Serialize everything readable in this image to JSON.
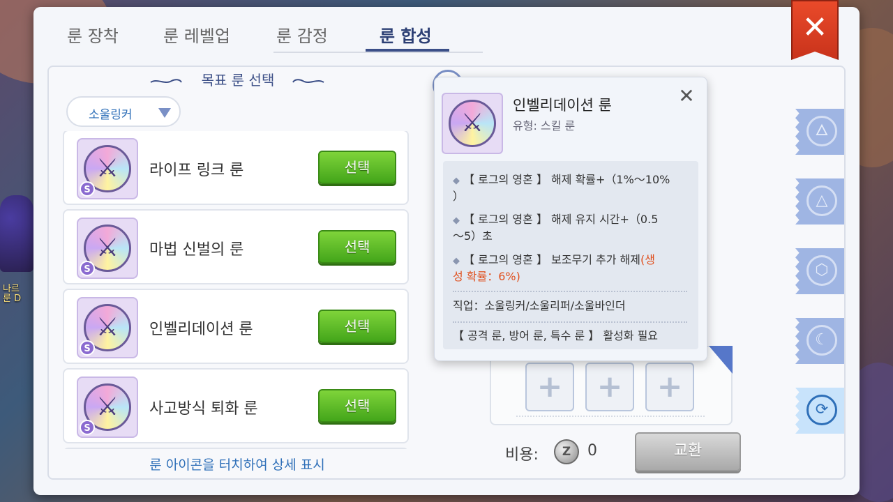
{
  "tabs": [
    {
      "label": "룬 장착",
      "active": false
    },
    {
      "label": "룬 레벨업",
      "active": false
    },
    {
      "label": "룬 감정",
      "active": false
    },
    {
      "label": "룬 합성",
      "active": true
    }
  ],
  "left_panel": {
    "title": "목표 룬 선택",
    "filter": {
      "selected": "소울링커"
    },
    "runes": [
      {
        "name": "라이프 링크 룬",
        "button": "선택",
        "badge": "S"
      },
      {
        "name": "마법 신벌의 룬",
        "button": "선택",
        "badge": "S"
      },
      {
        "name": "인벨리데이션 룬",
        "button": "선택",
        "badge": "S"
      },
      {
        "name": "사고방식 퇴화 룬",
        "button": "선택",
        "badge": "S"
      }
    ],
    "hint": "룬 아이콘을 터치하여 상세 표시"
  },
  "right_panel": {
    "cost_label": "비용:",
    "cost_icon": "Z",
    "cost_value": "0",
    "exchange_button": "교환",
    "plus_slots": [
      "+",
      "+",
      "+"
    ]
  },
  "background": {
    "left_text_1": "나르",
    "left_text_2": "룬 D"
  },
  "popup": {
    "title": "인벨리데이션 룬",
    "type": "유형: 스킬 룬",
    "close": "✕",
    "effects": [
      {
        "bullet": "◆",
        "text": "【 로그의 영혼 】 해제 확률+（1%～10%",
        "text2": "）"
      },
      {
        "bullet": "◆",
        "text": "【 로그의 영혼 】 해제 유지 시간+（0.5",
        "text2": "～5）초"
      },
      {
        "bullet": "◆",
        "text": "【 로그의 영혼 】 보조무기 추가 해제",
        "highlight": "(생",
        "text2_highlight": "성 확률：6%)"
      }
    ],
    "jobs": "직업：소울링커/소울리퍼/소울바인더",
    "activation": "【 공격 룬, 방어 룬, 특수 룬 】 활성화 필요"
  },
  "side_tabs": [
    {
      "icon": "flame-emblem-icon",
      "glyph": "🜂",
      "active": false
    },
    {
      "icon": "triangle-emblem-icon",
      "glyph": "△",
      "active": false
    },
    {
      "icon": "hexagon-emblem-icon",
      "glyph": "⬡",
      "active": false
    },
    {
      "icon": "moon-emblem-icon",
      "glyph": "☾",
      "active": false
    },
    {
      "icon": "synthesis-icon",
      "glyph": "⟳",
      "active": true
    }
  ],
  "colors": {
    "accent": "#3b4f88",
    "link": "#2e6fb8",
    "select_green": "#43a51a",
    "close_red": "#e94a2a",
    "warning_orange": "#e0501e"
  }
}
